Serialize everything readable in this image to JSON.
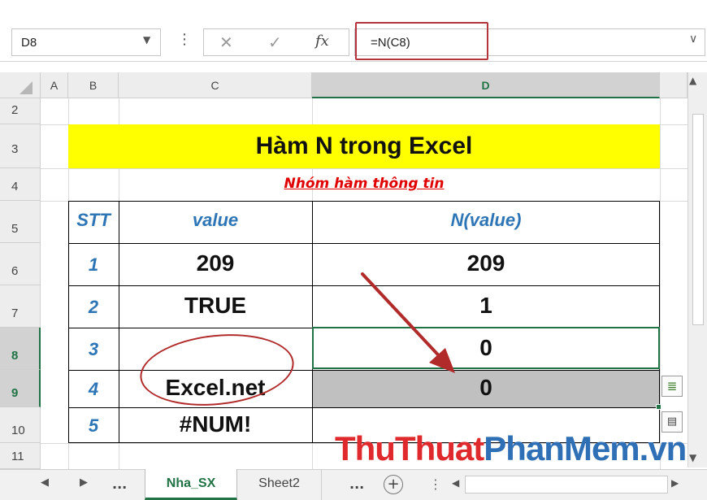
{
  "formula_bar": {
    "name_box": "D8",
    "formula": "=N(C8)",
    "fx_label": "fx"
  },
  "columns": [
    "A",
    "B",
    "C",
    "D"
  ],
  "rows": [
    "2",
    "3",
    "4",
    "5",
    "6",
    "7",
    "8",
    "9",
    "10",
    "11"
  ],
  "title": "Hàm N trong Excel",
  "subtitle": "Nhóm hàm thông tin",
  "table": {
    "headers": [
      "STT",
      "value",
      "N(value)"
    ],
    "rows": [
      {
        "stt": "1",
        "value": "209",
        "result": "209"
      },
      {
        "stt": "2",
        "value": "TRUE",
        "result": "1"
      },
      {
        "stt": "3",
        "value": "",
        "result": "0"
      },
      {
        "stt": "4",
        "value": "Excel.net",
        "result": "0"
      },
      {
        "stt": "5",
        "value": "#NUM!",
        "result": ""
      }
    ]
  },
  "sheet_tabs": {
    "nav_dots": "...",
    "active": "Nha_SX",
    "other": "Sheet2",
    "more_dots": "..."
  },
  "watermark": {
    "part1": "ThuThuat",
    "part2": "PhanMem",
    "part3": ".vn"
  },
  "colors": {
    "accent": "#217346",
    "title_fill": "#ffff00",
    "subtitle": "#e00000",
    "header_text": "#2e75b6",
    "annotation": "#b12b2b",
    "watermark_red": "#e0292d",
    "watermark_blue": "#2f6fb5"
  }
}
